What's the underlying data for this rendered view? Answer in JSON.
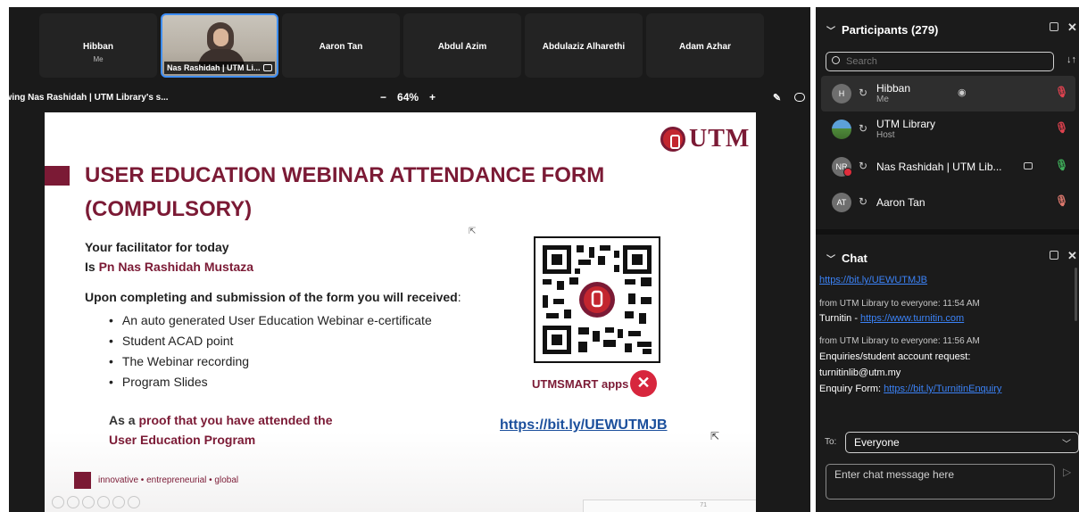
{
  "tiles": [
    {
      "name": "Hibban",
      "sub": "Me"
    },
    {
      "name": "Nas Rashidah | UTM Li...",
      "video": true
    },
    {
      "name": "Aaron Tan"
    },
    {
      "name": "Abdul Azim"
    },
    {
      "name": "Abdulaziz Alharethi"
    },
    {
      "name": "Adam Azhar"
    }
  ],
  "share_bar": {
    "viewing": "ewing Nas Rashidah | UTM Library's s...",
    "zoom_out": "−",
    "zoom": "64%",
    "zoom_in": "+"
  },
  "slide": {
    "logo_text": "UTM",
    "title": "USER EDUCATION WEBINAR ATTENDANCE FORM (COMPULSORY)",
    "facilitator_line1": "Your facilitator for today",
    "facilitator_prefix": "Is ",
    "facilitator_name": "Pn Nas Rashidah Mustaza",
    "upon_bold": "Upon completing and submission of the form you will received",
    "upon_colon": ":",
    "bullets": [
      "An auto generated User Education Webinar e-certificate",
      "Student ACAD point",
      "The Webinar recording",
      "Program Slides"
    ],
    "proof_a": "As a ",
    "proof_b": "proof that you have attended the",
    "proof_c": "User Education Program",
    "smart_label": "UTMSMART apps",
    "smart_x": "✕",
    "link": "https://bit.ly/UEWUTMJB",
    "footer": "innovative • entrepreneurial • global",
    "page": "71"
  },
  "participants": {
    "title": "Participants (279)",
    "search_placeholder": "Search",
    "sort_icon": "↓↑",
    "list": [
      {
        "initials": "H",
        "name": "Hibban",
        "role": "Me",
        "mic": "muted"
      },
      {
        "initials": "",
        "name": "UTM Library",
        "role": "Host",
        "mic": "muted"
      },
      {
        "initials": "NR",
        "name": "Nas Rashidah | UTM Lib...",
        "role": "",
        "mic": "live"
      },
      {
        "initials": "AT",
        "name": "Aaron Tan",
        "role": "",
        "mic": "idle"
      }
    ]
  },
  "chat": {
    "title": "Chat",
    "link1": "https://bit.ly/UEWUTMJB",
    "meta1": "from UTM Library to everyone:   11:54 AM",
    "msg1_prefix": "Turnitin - ",
    "msg1_link": "https://www.turnitin.com",
    "meta2": "from UTM Library to everyone:   11:56 AM",
    "msg2_line1": "Enquiries/student account request:",
    "msg2_line2": "turnitinlib@utm.my",
    "msg2_prefix": "Enquiry Form: ",
    "msg2_link": "https://bit.ly/TurnitinEnquiry",
    "to_label": "To:",
    "to_value": "Everyone",
    "input_placeholder": "Enter chat message here"
  },
  "colors": {
    "brand": "#7b1a35",
    "link": "#3b82f6",
    "muted_mic": "#e0424f",
    "live_mic": "#3fae5a"
  }
}
